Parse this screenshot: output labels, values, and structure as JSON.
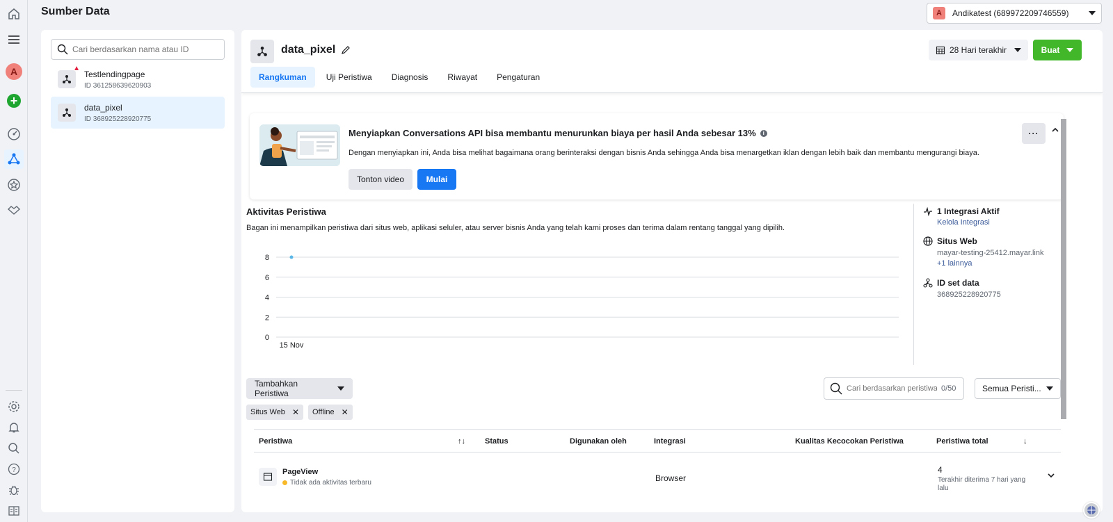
{
  "page": {
    "title": "Sumber Data"
  },
  "account": {
    "badge": "A",
    "name": "Andikatest (689972209746559)"
  },
  "rail": {
    "avatar_letter": "A"
  },
  "sources": {
    "search_placeholder": "Cari berdasarkan nama atau ID",
    "items": [
      {
        "name": "Testlendingpage",
        "id": "ID 361258639620903",
        "warning": true
      },
      {
        "name": "data_pixel",
        "id": "ID 368925228920775",
        "warning": false
      }
    ]
  },
  "pixel": {
    "name": "data_pixel",
    "tabs": [
      "Rangkuman",
      "Uji Peristiwa",
      "Diagnosis",
      "Riwayat",
      "Pengaturan"
    ],
    "active_tab": "Rangkuman",
    "date_range": "28 Hari terakhir",
    "create_label": "Buat"
  },
  "promo": {
    "title": "Menyiapkan Conversations API bisa membantu menurunkan biaya per hasil Anda sebesar 13%",
    "description": "Dengan menyiapkan ini, Anda bisa melihat bagaimana orang berinteraksi dengan bisnis Anda sehingga Anda bisa menargetkan iklan dengan lebih baik dan membantu mengurangi biaya.",
    "watch_label": "Tonton video",
    "start_label": "Mulai",
    "more_label": "···"
  },
  "activity": {
    "title": "Aktivitas Peristiwa",
    "description": "Bagan ini menampilkan peristiwa dari situs web, aplikasi seluler, atau server bisnis Anda yang telah kami proses dan terima dalam rentang tanggal yang dipilih."
  },
  "chart_data": {
    "type": "line",
    "x": [
      "15 Nov"
    ],
    "series": [
      {
        "values": [
          8
        ]
      }
    ],
    "yticks": [
      0,
      2,
      4,
      6,
      8
    ],
    "ylim": [
      0,
      8
    ],
    "color": "#5ab6e6"
  },
  "side": {
    "integrations_title": "1 Integrasi Aktif",
    "integrations_link": "Kelola Integrasi",
    "website_title": "Situs Web",
    "website_value": "mayar-testing-25412.mayar.link",
    "website_more": "+1 lainnya",
    "dataset_title": "ID set data",
    "dataset_value": "368925228920775"
  },
  "events": {
    "add_label": "Tambahkan Peristiwa",
    "search_placeholder": "Cari berdasarkan peristiwa",
    "search_count": "0/50",
    "filter_label": "Semua Peristi...",
    "chips": [
      "Situs Web",
      "Offline"
    ],
    "columns": [
      "Peristiwa",
      "Status",
      "Digunakan oleh",
      "Integrasi",
      "Kualitas Kecocokan Peristiwa",
      "Peristiwa total"
    ],
    "rows": [
      {
        "name": "PageView",
        "status_note": "Tidak ada aktivitas terbaru",
        "integration": "Browser",
        "total": "4",
        "total_note": "Terakhir diterima 7 hari yang lalu"
      }
    ]
  }
}
